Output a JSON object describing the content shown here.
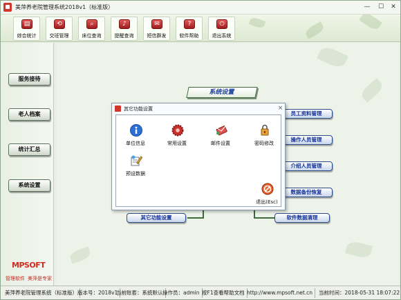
{
  "window": {
    "title": "美萍养老院管理系统2018v1（标准版）",
    "minimize_glyph": "—",
    "maximize_glyph": "☐",
    "close_glyph": "✕"
  },
  "toolbar": {
    "buttons": [
      {
        "label": "综合统计",
        "icon": "stats-icon"
      },
      {
        "label": "交班管理",
        "icon": "handover-icon"
      },
      {
        "label": "床位查询",
        "icon": "bed-search-icon"
      },
      {
        "label": "提醒查询",
        "icon": "reminder-icon"
      },
      {
        "label": "短信群发",
        "icon": "sms-icon"
      },
      {
        "label": "软件帮助",
        "icon": "help-icon"
      },
      {
        "label": "退出系统",
        "icon": "exit-icon"
      }
    ]
  },
  "sidebar": {
    "items": [
      {
        "label": "服务接待"
      },
      {
        "label": "老人档案"
      },
      {
        "label": "统计汇总"
      },
      {
        "label": "系统设置"
      }
    ],
    "logo": "MPSOFT",
    "tagline_left": "管理软件",
    "tagline_right": "美萍是专家"
  },
  "diagram": {
    "title": "系统设置",
    "modules": [
      {
        "label": "员工资料管理"
      },
      {
        "label": "操作人员管理"
      },
      {
        "label": "介绍人员管理"
      },
      {
        "label": "数据备份恢复"
      },
      {
        "label": "软件数据清理"
      },
      {
        "label": "其它功能设置"
      }
    ]
  },
  "dialog": {
    "title": "其它功能设置",
    "close_glyph": "⨯",
    "items": [
      {
        "label": "单位信息",
        "icon": "info-icon"
      },
      {
        "label": "常用设置",
        "icon": "gear-icon"
      },
      {
        "label": "邮件设置",
        "icon": "mail-icon"
      },
      {
        "label": "密码修改",
        "icon": "password-icon"
      },
      {
        "label": "预设数据",
        "icon": "preset-data-icon"
      },
      {
        "label": "退出(Esc)",
        "icon": "exit-icon"
      }
    ]
  },
  "status": {
    "product": "美萍养老院管理系统（标准版）",
    "version": "版本号：2018v1",
    "account": "当前账套：系统默认",
    "operator": "操作员：admin",
    "help": "按F1查看帮助文档",
    "website": "http://www.mpsoft.net.cn",
    "time": "当前时间：2018-05-31 18:07:22"
  }
}
